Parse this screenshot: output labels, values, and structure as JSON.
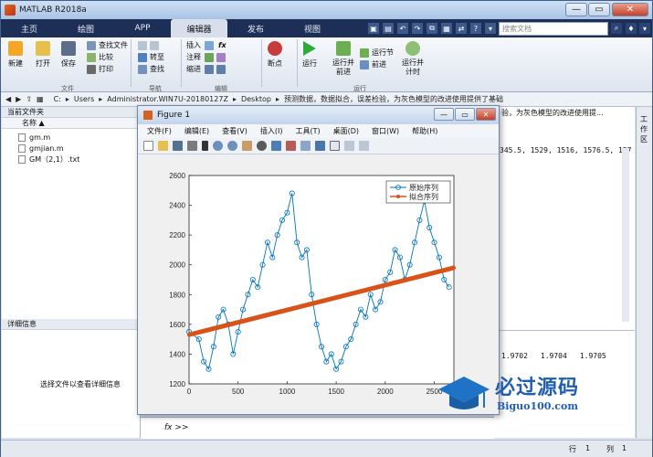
{
  "app": {
    "title": "MATLAB R2018a",
    "window_controls": [
      "—",
      "▭",
      "✕"
    ]
  },
  "tabs": [
    "主页",
    "绘图",
    "APP",
    "编辑器",
    "发布",
    "视图"
  ],
  "active_tab": "编辑器",
  "search": {
    "placeholder": "搜索文档"
  },
  "ribbon": {
    "file_group": {
      "label": "文件",
      "new": "新建",
      "open": "打开",
      "save": "保存",
      "find_files": "查找文件",
      "compare": "比较",
      "print": "打印"
    },
    "nav_group": {
      "label": "导航",
      "goto": "转至",
      "find": "查找"
    },
    "edit_group": {
      "label": "编辑",
      "insert": "插入",
      "comment": "注释",
      "indent": "缩进",
      "fx": "fx"
    },
    "run_group": {
      "label": "运行",
      "breakpoints": "断点",
      "run": "运行",
      "run_advance": "运行并前进",
      "run_section": "运行节",
      "advance": "前进",
      "run_time": "运行并计时"
    }
  },
  "path": [
    "C:",
    "Users",
    "Administrator.WIN7U-20180127Z",
    "Desktop",
    "预测数据，数据拟合，误差检验，为灰色模型的改进使用提供了基础"
  ],
  "left_panel": {
    "title": "当前文件夹",
    "col_name": "名称",
    "files": [
      "gm.m",
      "gmjian.m",
      "GM（2,1）.txt"
    ],
    "details_title": "详细信息",
    "details_hint": "选择文件以查看详细信息"
  },
  "right_panel": {
    "path_tail": "验，为灰色模型的改进使用提...",
    "data_line": "345.5, 1529, 1516, 1576.5, 157",
    "values": [
      "1.9702",
      "1.9704",
      "1.9705"
    ],
    "side_tab": "工作区"
  },
  "figure": {
    "title": "Figure 1",
    "controls": [
      "—",
      "▭",
      "✕"
    ],
    "menu": [
      "文件(F)",
      "编辑(E)",
      "查看(V)",
      "插入(I)",
      "工具(T)",
      "桌面(D)",
      "窗口(W)",
      "帮助(H)"
    ]
  },
  "status": {
    "row_label": "行",
    "row": "1",
    "col_label": "列",
    "col": "1"
  },
  "command": {
    "prompt": "fx >>"
  },
  "watermark": {
    "cn": "必过源码",
    "url": "Biguo100.com"
  },
  "colors": {
    "accent": "#1e2f57",
    "series1": "#0072BD",
    "series2": "#D95319"
  },
  "chart_data": {
    "type": "line",
    "title": "",
    "xlabel": "",
    "ylabel": "",
    "xlim": [
      0,
      2700
    ],
    "ylim": [
      1200,
      2600
    ],
    "xticks": [
      0,
      500,
      1000,
      1500,
      2000,
      2500
    ],
    "yticks": [
      1200,
      1400,
      1600,
      1800,
      2000,
      2200,
      2400,
      2600
    ],
    "legend_position": "top-right",
    "series": [
      {
        "name": "原始序列",
        "marker": "circle",
        "color": "#0072BD",
        "x": [
          0,
          100,
          150,
          200,
          250,
          300,
          350,
          400,
          450,
          500,
          550,
          600,
          650,
          700,
          750,
          800,
          850,
          900,
          950,
          1000,
          1050,
          1100,
          1150,
          1200,
          1250,
          1300,
          1350,
          1400,
          1450,
          1500,
          1550,
          1600,
          1650,
          1700,
          1750,
          1800,
          1850,
          1900,
          1950,
          2000,
          2050,
          2100,
          2150,
          2200,
          2250,
          2300,
          2350,
          2400,
          2450,
          2500,
          2550,
          2600,
          2650
        ],
        "y": [
          1550,
          1500,
          1350,
          1300,
          1450,
          1650,
          1700,
          1600,
          1400,
          1550,
          1700,
          1800,
          1900,
          1850,
          2000,
          2150,
          2050,
          2200,
          2300,
          2350,
          2480,
          2150,
          2050,
          2100,
          1800,
          1600,
          1450,
          1350,
          1400,
          1300,
          1350,
          1450,
          1500,
          1600,
          1700,
          1650,
          1800,
          1700,
          1750,
          1900,
          1950,
          2100,
          2050,
          1900,
          2000,
          2150,
          2300,
          2430,
          2250,
          2150,
          2050,
          1900,
          1850
        ]
      },
      {
        "name": "拟合序列",
        "marker": "star",
        "color": "#D95319",
        "x": [
          0,
          2700
        ],
        "y": [
          1530,
          1980
        ]
      }
    ]
  }
}
